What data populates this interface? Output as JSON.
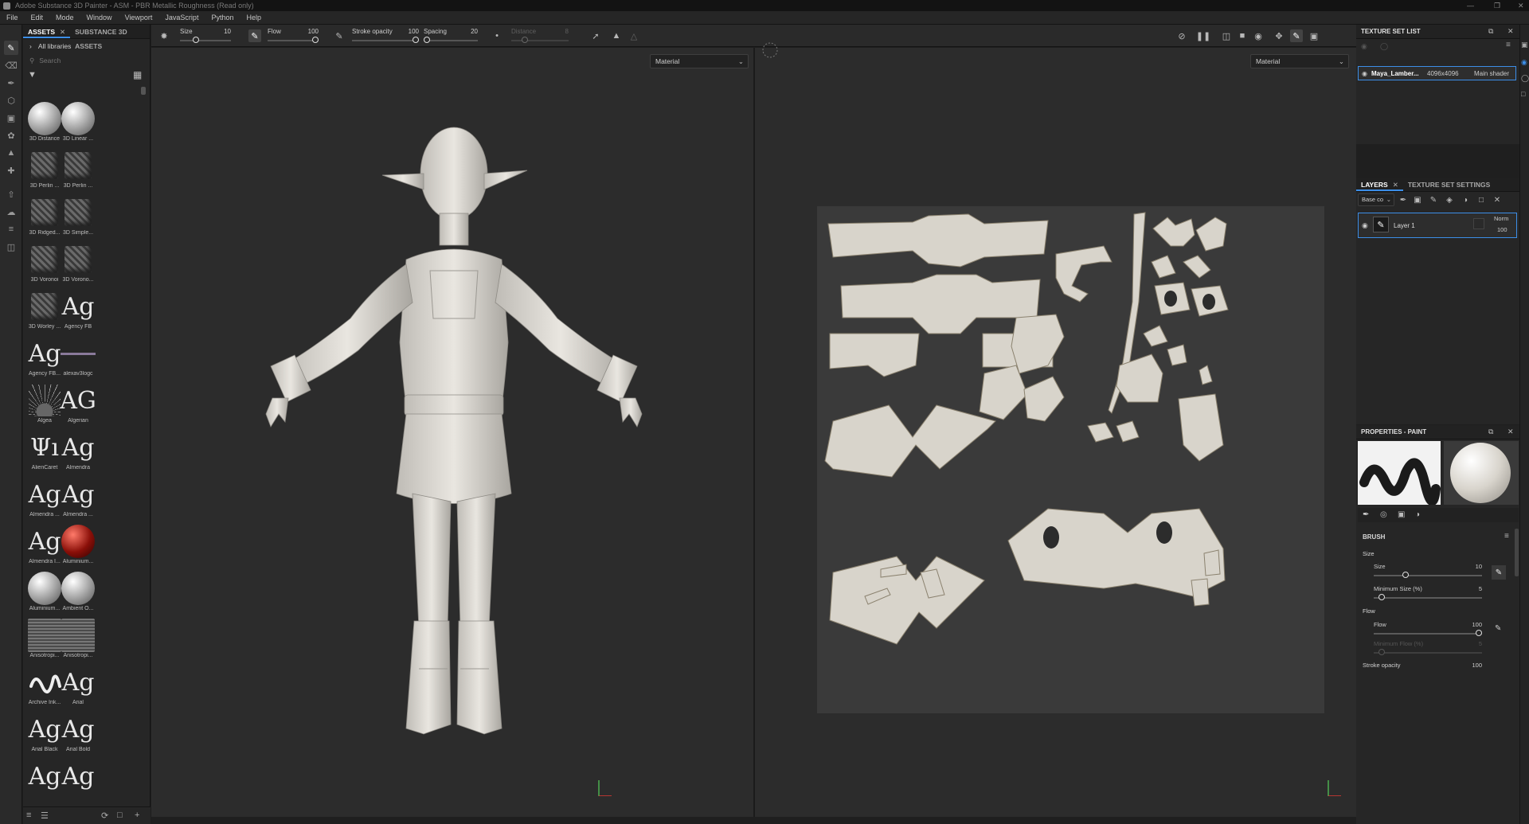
{
  "window": {
    "title": "Adobe Substance 3D Painter - ASM - PBR Metallic Roughness (Read only)"
  },
  "menu": [
    "File",
    "Edit",
    "Mode",
    "Window",
    "Viewport",
    "JavaScript",
    "Python",
    "Help"
  ],
  "assets": {
    "tabs": [
      {
        "label": "ASSETS",
        "active": true
      },
      {
        "label": "SUBSTANCE 3D ASSETS",
        "active": false
      }
    ],
    "library": "All libraries",
    "search_placeholder": "Search",
    "items": [
      {
        "label": "3D Distance",
        "thumb": "sphere-icon"
      },
      {
        "label": "3D Linear ...",
        "thumb": "sphere-icon"
      },
      {
        "label": "3D Perlin ...",
        "thumb": "noise-cube-icon"
      },
      {
        "label": "3D Perlin ...",
        "thumb": "noise-cube-icon"
      },
      {
        "label": "3D Ridged...",
        "thumb": "noise-cube-icon"
      },
      {
        "label": "3D Simple...",
        "thumb": "noise-cube-icon"
      },
      {
        "label": "3D Voronoi",
        "thumb": "noise-cube-icon"
      },
      {
        "label": "3D Vorono...",
        "thumb": "noise-cube-icon"
      },
      {
        "label": "3D Worley ...",
        "thumb": "noise-cube-icon"
      },
      {
        "label": "Agency FB",
        "thumb": "font-icon",
        "glyph": "Ag"
      },
      {
        "label": "Agency FB...",
        "thumb": "font-icon",
        "glyph": "Ag"
      },
      {
        "label": "alexav3logc",
        "thumb": "line-icon"
      },
      {
        "label": "Algea",
        "thumb": "spark-icon"
      },
      {
        "label": "Algerian",
        "thumb": "font-icon",
        "glyph": "AG"
      },
      {
        "label": "AlienCaret",
        "thumb": "font-icon",
        "glyph": "Ψı"
      },
      {
        "label": "Almendra",
        "thumb": "font-icon",
        "glyph": "Ag"
      },
      {
        "label": "Almendra ...",
        "thumb": "font-icon",
        "glyph": "Ag"
      },
      {
        "label": "Almendra ...",
        "thumb": "font-icon",
        "glyph": "Ag"
      },
      {
        "label": "Almendra I...",
        "thumb": "font-icon",
        "glyph": "Ag"
      },
      {
        "label": "Aluminium...",
        "thumb": "red-sphere-icon"
      },
      {
        "label": "Aluminium...",
        "thumb": "sphere-icon"
      },
      {
        "label": "Ambient O...",
        "thumb": "sphere-icon"
      },
      {
        "label": "Anisotropi...",
        "thumb": "aniso-icon"
      },
      {
        "label": "Anisotropi...",
        "thumb": "aniso-icon"
      },
      {
        "label": "Archive Ink...",
        "thumb": "stroke-icon"
      },
      {
        "label": "Arial",
        "thumb": "font-icon",
        "glyph": "Ag"
      },
      {
        "label": "Arial Black",
        "thumb": "font-icon",
        "glyph": "Ag"
      },
      {
        "label": "Arial Bold",
        "thumb": "font-icon",
        "glyph": "Ag"
      },
      {
        "label": "",
        "thumb": "font-icon",
        "glyph": "Ag"
      },
      {
        "label": "",
        "thumb": "font-icon",
        "glyph": "Ag"
      }
    ]
  },
  "toolbar": {
    "size": {
      "label": "Size",
      "value": "10",
      "fraction": 0.28
    },
    "flow": {
      "label": "Flow",
      "value": "100",
      "fraction": 1.0
    },
    "stroke_opacity": {
      "label": "Stroke opacity",
      "value": "100",
      "fraction": 1.0
    },
    "spacing": {
      "label": "Spacing",
      "value": "20",
      "fraction": 0.0
    },
    "distance": {
      "label": "Distance",
      "value": "8",
      "fraction": 0.2
    }
  },
  "viewport3d": {
    "channel": "Material"
  },
  "viewport2d": {
    "channel": "Material"
  },
  "texture_set_list": {
    "title": "TEXTURE SET LIST",
    "set_name": "Maya_Lamber...",
    "resolution": "4096x4096",
    "shader": "Main shader"
  },
  "layers": {
    "tabs": [
      {
        "label": "LAYERS",
        "active": true
      },
      {
        "label": "TEXTURE SET SETTINGS",
        "active": false
      }
    ],
    "channel": "Base co",
    "items": [
      {
        "name": "Layer 1",
        "blend": "Norm",
        "opacity": "100"
      }
    ]
  },
  "properties": {
    "title": "PROPERTIES - PAINT",
    "section": "BRUSH",
    "size_group": "Size",
    "size": {
      "label": "Size",
      "value": "10",
      "fraction": 0.28
    },
    "min_size": {
      "label": "Minimum Size (%)",
      "value": "5",
      "fraction": 0.05
    },
    "flow_group": "Flow",
    "flow": {
      "label": "Flow",
      "value": "100",
      "fraction": 1.0
    },
    "min_flow": {
      "label": "Minimum Flow (%)",
      "value": "5",
      "fraction": 0.05
    },
    "stroke_opacity": {
      "label": "Stroke opacity",
      "value": "100"
    }
  },
  "colors": {
    "accent": "#3c8ee8",
    "bg": "#262626",
    "viewport": "#2c2c2c"
  }
}
